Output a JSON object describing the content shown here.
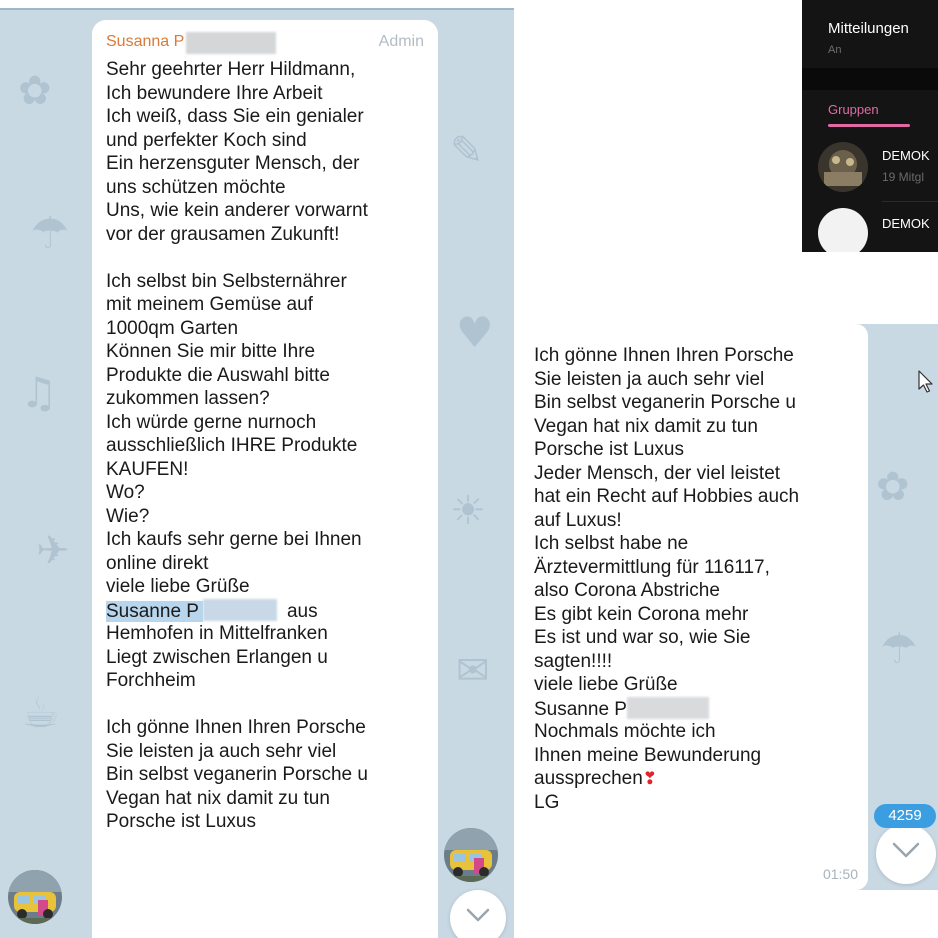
{
  "left_chat": {
    "sender": "Susanna P",
    "role": "Admin",
    "lines": [
      "Sehr geehrter Herr Hildmann,",
      "Ich bewundere Ihre Arbeit",
      "Ich weiß, dass Sie ein genialer",
      "und perfekter Koch sind",
      "Ein herzensguter Mensch, der",
      "uns schützen möchte",
      "Uns, wie kein anderer vorwarnt",
      "vor der grausamen Zukunft!",
      "",
      "Ich selbst bin Selbsternährer",
      "mit meinem Gemüse auf",
      "1000qm Garten",
      "Können Sie mir bitte Ihre",
      "Produkte die Auswahl bitte",
      "zukommen lassen?",
      "Ich würde gerne nurnoch",
      "ausschließlich IHRE Produkte",
      "KAUFEN!",
      "Wo?",
      "Wie?",
      "Ich kaufs sehr gerne bei Ihnen",
      "online direkt",
      "viele liebe Grüße"
    ],
    "signature_name": "Susanne P",
    "signature_suffix": "aus",
    "lines_after_signature": [
      "Hemhofen in Mittelfranken",
      "Liegt zwischen Erlangen u",
      "Forchheim",
      "",
      "Ich gönne Ihnen Ihren Porsche",
      "Sie leisten ja auch sehr viel",
      "Bin selbst veganerin Porsche u",
      "Vegan hat nix damit zu tun",
      "Porsche ist Luxus"
    ]
  },
  "settings_panel": {
    "title": "Mitteilungen",
    "subtitle": "An",
    "tab_label": "Gruppen",
    "groups": [
      {
        "name": "DEMOK",
        "meta": "19 Mitgl"
      },
      {
        "name": "DEMOK"
      }
    ]
  },
  "right_chat": {
    "lines_before_name": [
      "Ich gönne Ihnen Ihren Porsche",
      "Sie leisten ja auch sehr viel",
      "Bin selbst veganerin Porsche u",
      "Vegan hat nix damit zu tun",
      "Porsche ist Luxus",
      "Jeder Mensch, der viel leistet",
      "hat ein Recht auf Hobbies auch",
      "auf Luxus!",
      "Ich selbst habe ne",
      "Ärztevermittlung für 116117,",
      "also Corona Abstriche",
      "Es gibt kein Corona mehr",
      "Es ist und war so, wie Sie",
      "sagten!!!!",
      "viele liebe Grüße"
    ],
    "signature_name": "Susanne P",
    "lines_after_name": [
      "Nochmals möchte ich",
      "Ihnen meine Bewunderung"
    ],
    "last_line_text": "aussprechen",
    "heart": "❣",
    "closing": "LG",
    "time": "01:50",
    "unread_count": "4259"
  },
  "colors": {
    "chat_bg": "#c9d9e4",
    "sender_name": "#d97a36",
    "badge": "#3a9ee0",
    "tab_accent": "#e26aa4"
  },
  "icons": [
    "chevron-down-icon",
    "mouse-cursor-icon",
    "heart-exclamation-icon"
  ]
}
